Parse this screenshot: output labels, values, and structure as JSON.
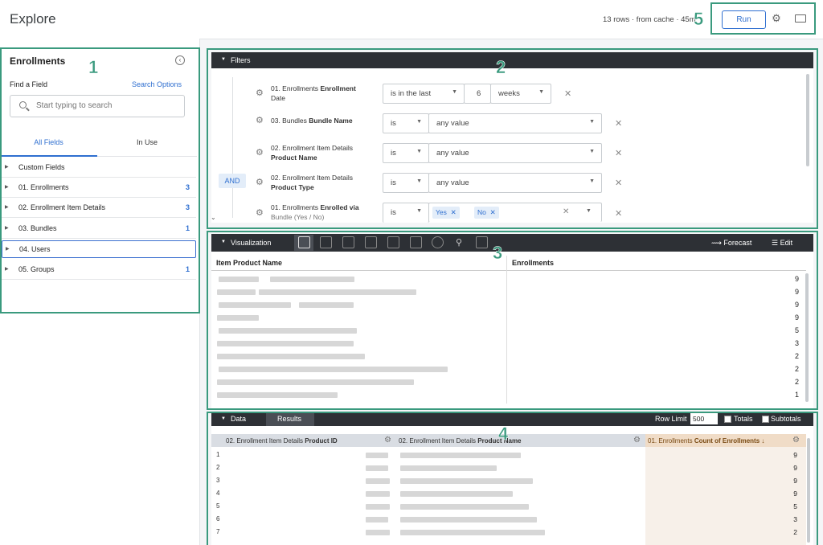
{
  "header": {
    "title": "Explore",
    "status": "13 rows · from cache · 45m",
    "run_label": "Run"
  },
  "annotations": [
    "1",
    "2",
    "3",
    "4",
    "5"
  ],
  "sidebar": {
    "title": "Enrollments",
    "find_label": "Find a Field",
    "search_options": "Search Options",
    "search_placeholder": "Start typing to search",
    "tabs": [
      "All Fields",
      "In Use"
    ],
    "items": [
      {
        "label": "Custom Fields",
        "count": ""
      },
      {
        "label": "01. Enrollments",
        "count": "3"
      },
      {
        "label": "02. Enrollment Item Details",
        "count": "3"
      },
      {
        "label": "03. Bundles",
        "count": "1"
      },
      {
        "label": "04. Users",
        "count": ""
      },
      {
        "label": "05. Groups",
        "count": "1"
      }
    ]
  },
  "filters": {
    "title": "Filters",
    "and_label": "AND",
    "rows": [
      {
        "view": "01. Enrollments",
        "field": "Enrollment",
        "field2": "Date",
        "op": "is in the last",
        "value": "6",
        "unit": "weeks"
      },
      {
        "view": "03. Bundles",
        "field": "Bundle Name",
        "op": "is",
        "value": "any value"
      },
      {
        "view": "02. Enrollment Item Details",
        "field2": "Product Name",
        "op": "is",
        "value": "any value"
      },
      {
        "view": "02. Enrollment Item Details",
        "field2": "Product Type",
        "op": "is",
        "value": "any value"
      },
      {
        "view": "01. Enrollments",
        "field": "Enrolled via",
        "field2": "Bundle (Yes / No)",
        "op": "is",
        "chips": [
          "Yes",
          "No"
        ]
      }
    ]
  },
  "visualization": {
    "title": "Visualization",
    "forecast": "Forecast",
    "edit": "Edit",
    "col1": "Item Product Name",
    "col2": "Enrollments",
    "values": [
      "9",
      "9",
      "9",
      "9",
      "5",
      "3",
      "2",
      "2",
      "2",
      "1"
    ]
  },
  "data": {
    "tab_data": "Data",
    "tab_results": "Results",
    "row_limit_label": "Row Limit",
    "row_limit": "500",
    "totals": "Totals",
    "subtotals": "Subtotals",
    "col1_view": "02. Enrollment Item Details ",
    "col1_field": "Product ID",
    "col2_view": "02. Enrollment Item Details ",
    "col2_field": "Product Name",
    "col3_view": "01. Enrollments ",
    "col3_field": "Count of Enrollments",
    "rows": [
      "1",
      "2",
      "3",
      "4",
      "5",
      "6",
      "7"
    ],
    "values": [
      "9",
      "9",
      "9",
      "9",
      "5",
      "3",
      "2"
    ]
  },
  "colors": {
    "accent": "#2f6fd0",
    "annotation": "#3a9a7e",
    "bar": "#2d3035"
  }
}
